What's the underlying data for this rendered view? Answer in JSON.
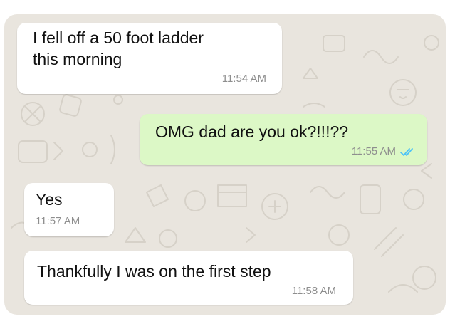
{
  "chat": {
    "messages": [
      {
        "direction": "incoming",
        "text": "I fell off a 50 foot ladder\nthis morning",
        "time": "11:54 AM"
      },
      {
        "direction": "outgoing",
        "text": "OMG dad are you ok?!!!??",
        "time": "11:55 AM",
        "status": "read-double-check-icon"
      },
      {
        "direction": "incoming",
        "text": "Yes",
        "time": "11:57 AM"
      },
      {
        "direction": "incoming",
        "text": "Thankfully I was on the first step",
        "time": "11:58 AM"
      }
    ]
  },
  "colors": {
    "wallpaper": "#e9e5de",
    "incoming_bubble": "#ffffff",
    "outgoing_bubble": "#dcf8c6",
    "timestamp": "#8e8e8e",
    "read_ticks": "#4fc3f7"
  }
}
